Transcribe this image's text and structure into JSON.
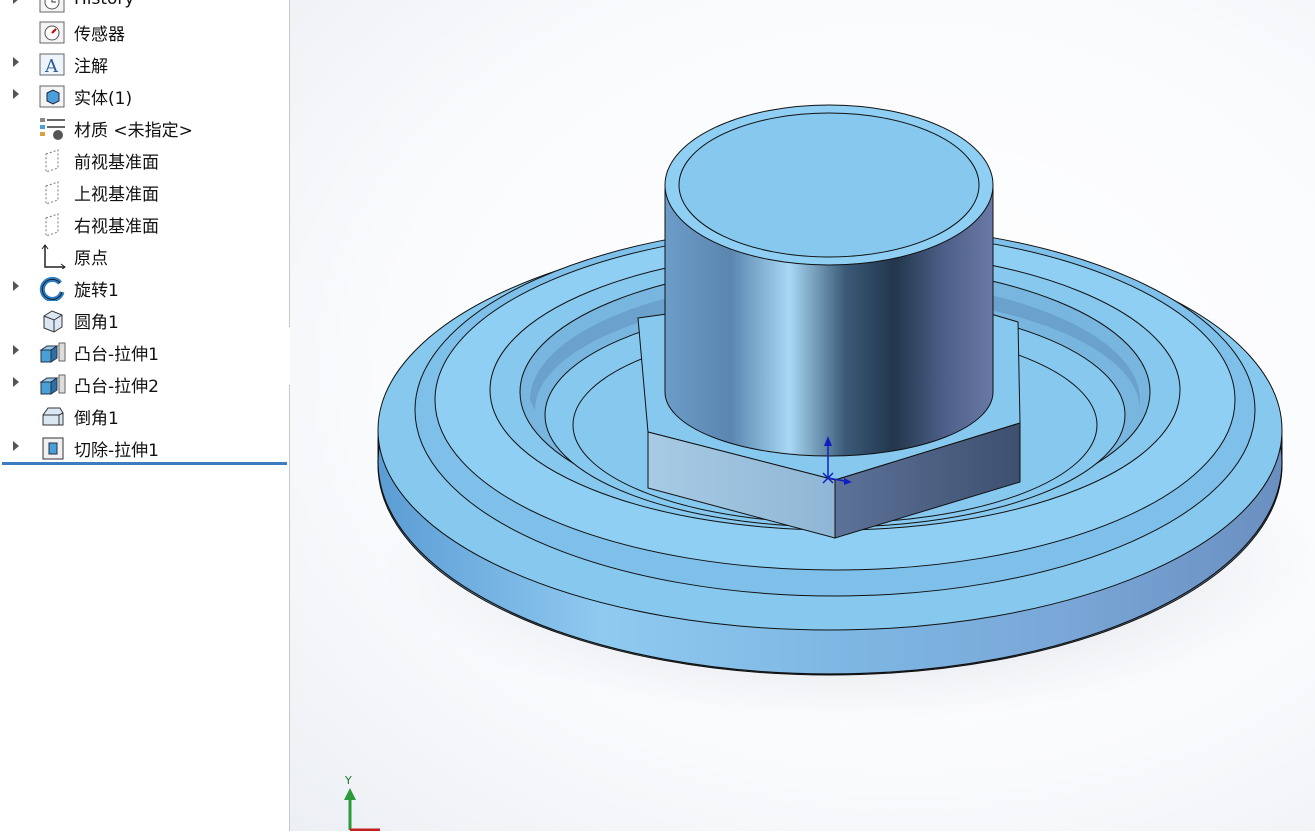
{
  "feature_tree": {
    "items": [
      {
        "label": "History",
        "icon": "history-icon",
        "expandable": true
      },
      {
        "label": "传感器",
        "icon": "sensor-icon",
        "expandable": false
      },
      {
        "label": "注解",
        "icon": "annotation-icon",
        "expandable": true
      },
      {
        "label": "实体(1)",
        "icon": "solid-body-icon",
        "expandable": true
      },
      {
        "label": "材质 <未指定>",
        "icon": "material-icon",
        "expandable": false
      },
      {
        "label": "前视基准面",
        "icon": "plane-icon",
        "expandable": false
      },
      {
        "label": "上视基准面",
        "icon": "plane-icon",
        "expandable": false
      },
      {
        "label": "右视基准面",
        "icon": "plane-icon",
        "expandable": false
      },
      {
        "label": "原点",
        "icon": "origin-icon",
        "expandable": false
      },
      {
        "label": "旋转1",
        "icon": "revolve-icon",
        "expandable": true
      },
      {
        "label": "圆角1",
        "icon": "fillet-icon",
        "expandable": false
      },
      {
        "label": "凸台-拉伸1",
        "icon": "boss-extrude-icon",
        "expandable": true
      },
      {
        "label": "凸台-拉伸2",
        "icon": "boss-extrude-icon",
        "expandable": true
      },
      {
        "label": "倒角1",
        "icon": "chamfer-icon",
        "expandable": false
      },
      {
        "label": "切除-拉伸1",
        "icon": "cut-extrude-icon",
        "expandable": true
      }
    ]
  },
  "triad": {
    "y_label": "Y"
  },
  "colors": {
    "part_blue": "#86c8ee",
    "selection_line": "#3b7dc0",
    "triad_y": "#2a9a3a"
  }
}
